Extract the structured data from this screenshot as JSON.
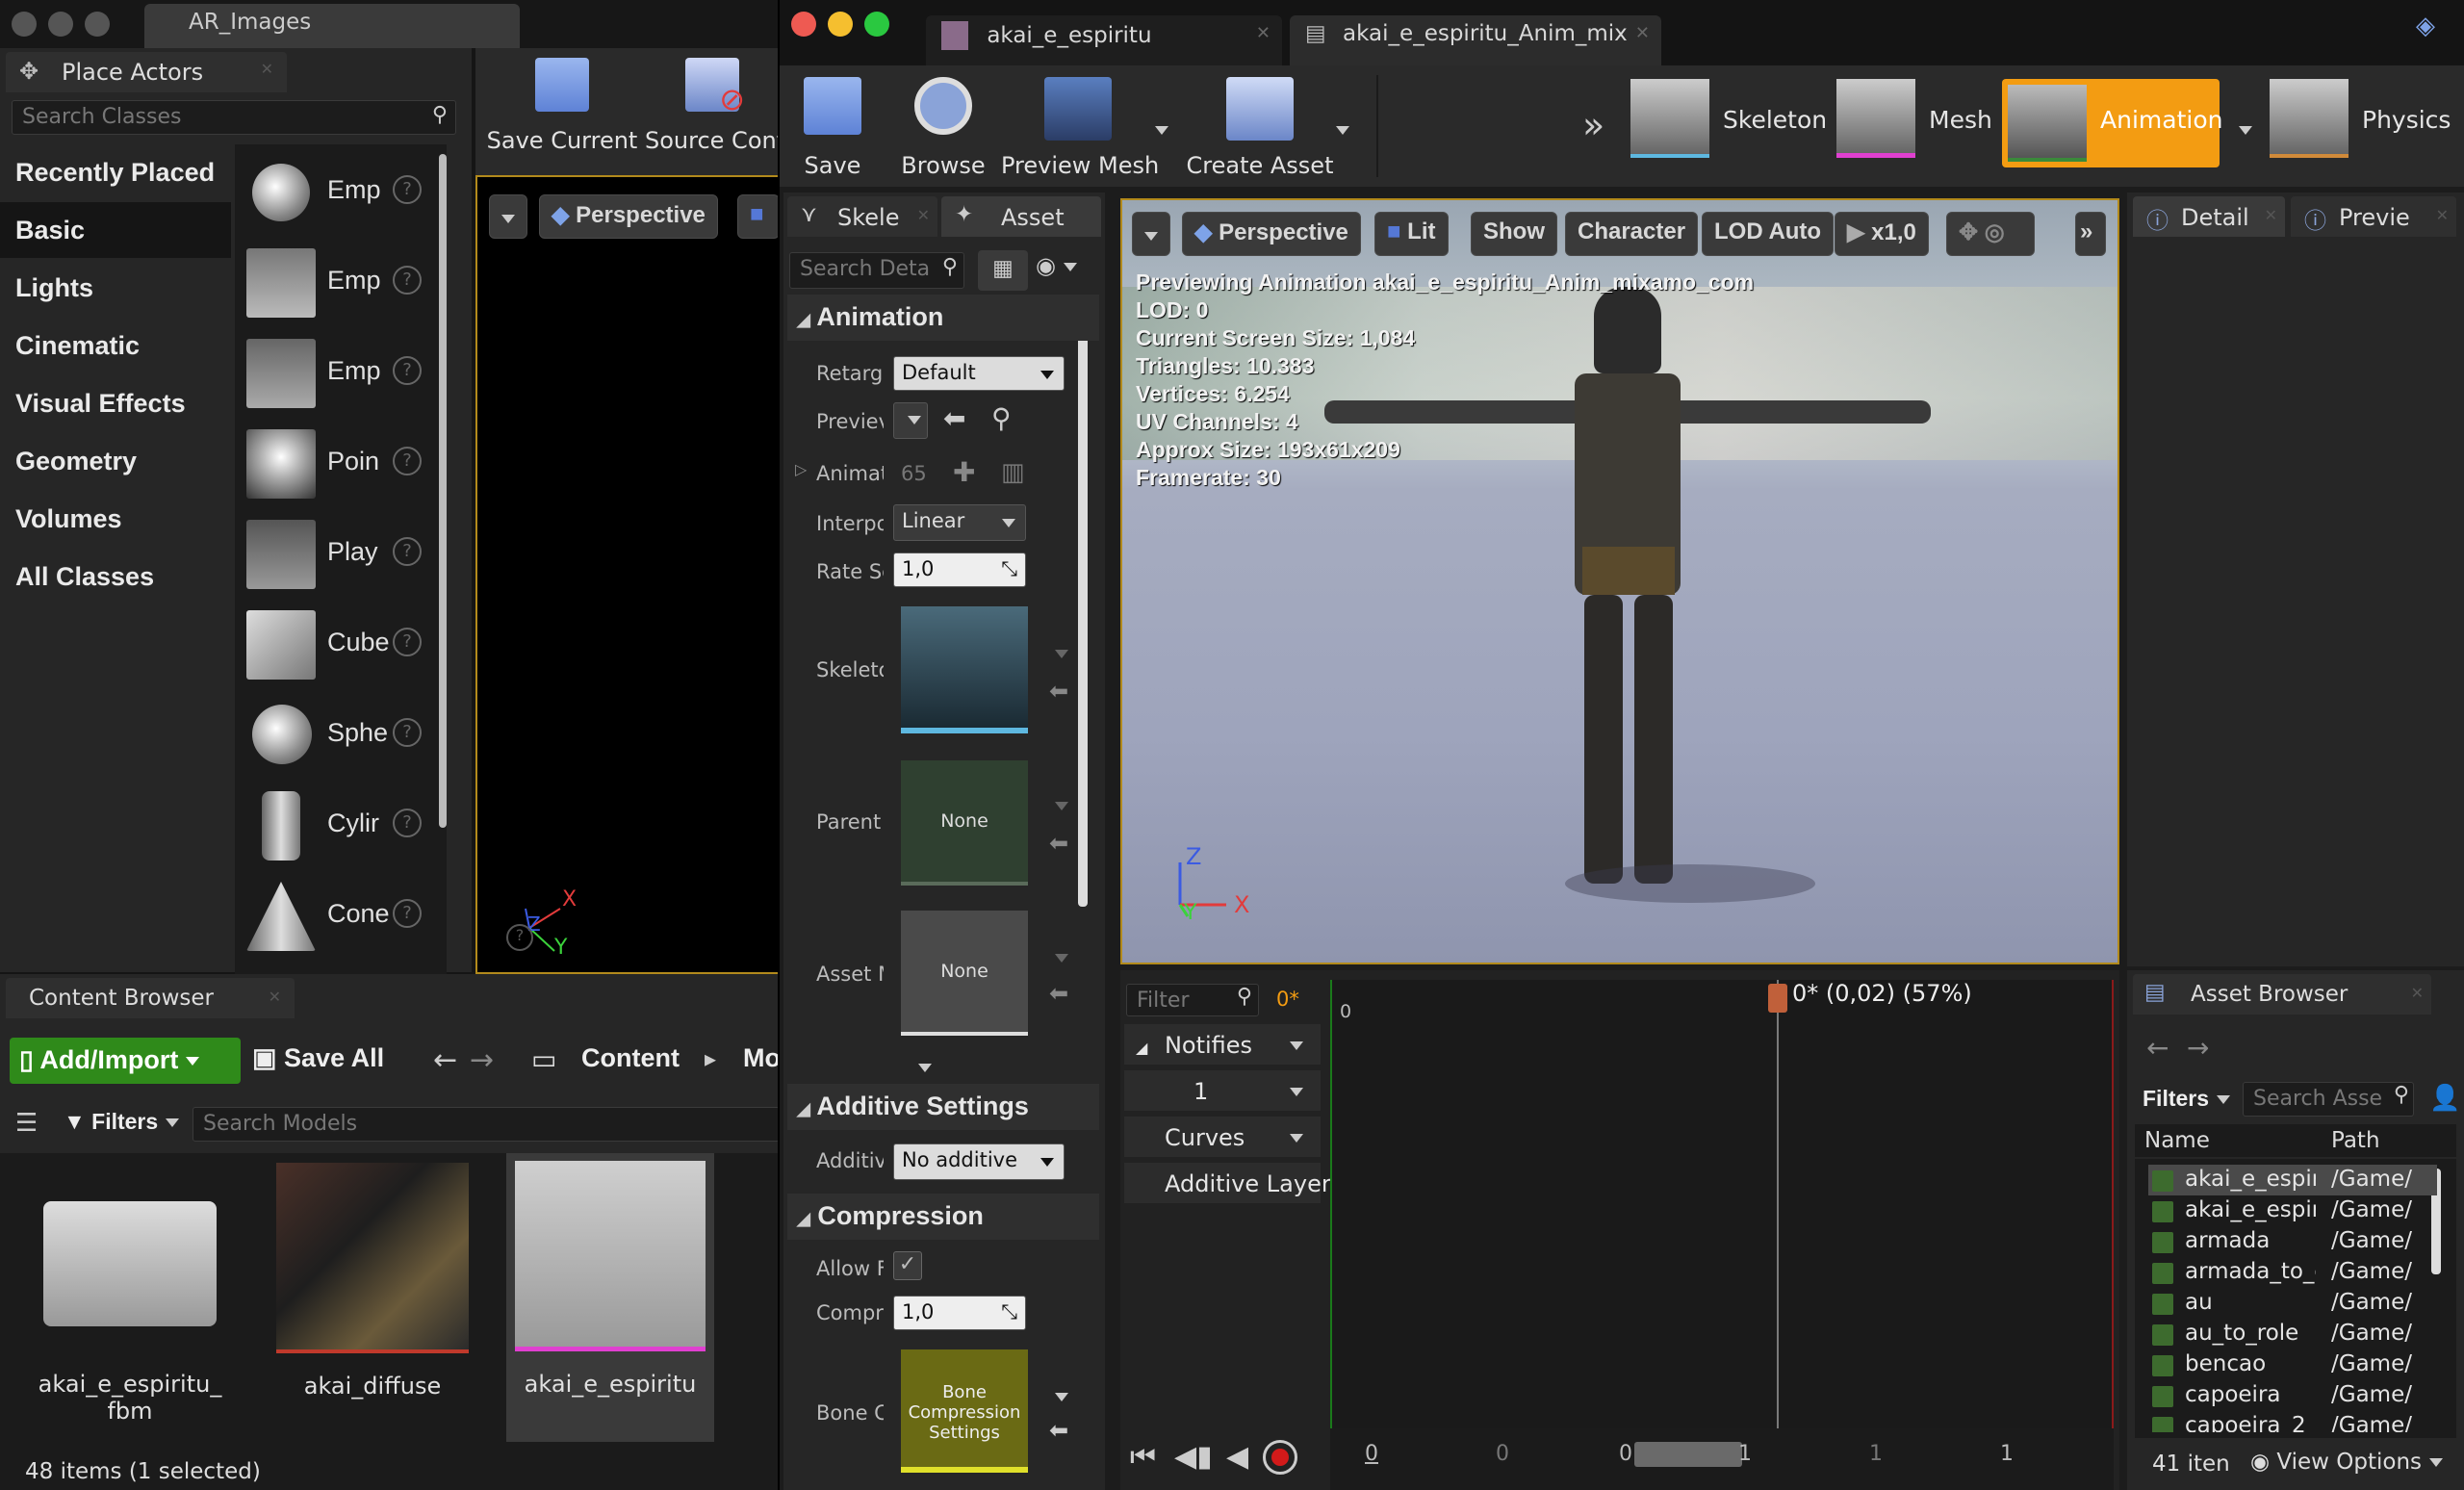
{
  "colors": {
    "accent_orange": "#f39c12",
    "green_button": "#2f8a1a",
    "viewport_gold": "#b28a1c",
    "pink_bar": "#e040d0"
  },
  "left_window": {
    "tab_title": "AR_Images"
  },
  "place_actors": {
    "tab": "Place Actors",
    "search_placeholder": "Search Classes",
    "categories": [
      "Recently Placed",
      "Basic",
      "Lights",
      "Cinematic",
      "Visual Effects",
      "Geometry",
      "Volumes",
      "All Classes"
    ],
    "selected_category": "Basic",
    "actors": [
      "Emp",
      "Emp",
      "Emp",
      "Poin",
      "Play",
      "Cube",
      "Sphe",
      "Cylir",
      "Cone"
    ]
  },
  "level_toolbar": {
    "save_current": "Save Current",
    "source_control": "Source Cont"
  },
  "level_viewport": {
    "perspective": "Perspective",
    "axis_x": "X",
    "axis_y": "Y",
    "axis_z": "Z"
  },
  "content_browser": {
    "tab": "Content Browser",
    "add_import": "Add/Import",
    "save_all": "Save All",
    "path_root": "Content",
    "path_next": "Mo",
    "filters": "Filters",
    "search_placeholder": "Search Models",
    "items": [
      "akai_e_espiritu_ fbm",
      "akai_diffuse",
      "akai_e_espiritu"
    ],
    "status": "48 items (1 selected)"
  },
  "anim_window": {
    "tabs": [
      "akai_e_espiritu",
      "akai_e_espiritu_Anim_mix"
    ],
    "toolbar": [
      "Save",
      "Browse",
      "Preview Mesh",
      "Create Asset"
    ],
    "modes": [
      "Skeleton",
      "Mesh",
      "Animation",
      "Physics"
    ],
    "active_mode": "Animation"
  },
  "details_panel": {
    "tabs": [
      "Skelet",
      "Asset"
    ],
    "search_placeholder": "Search Deta",
    "animation_section": "Animation",
    "props": {
      "retarget": "Retarge",
      "retarget_val": "Default",
      "preview": "Previev",
      "animation": "Animati",
      "animation_count": "65",
      "interp": "Interpol",
      "interp_val": "Linear",
      "rate": "Rate Sc",
      "rate_val": "1,0",
      "skeleton": "Skeleto",
      "parent": "Parent",
      "parent_val": "None",
      "asset_m": "Asset M",
      "asset_m_val": "None"
    },
    "additive_section": "Additive Settings",
    "additive": "Additiv",
    "additive_val": "No additive",
    "compression_section": "Compression",
    "allow": "Allow F",
    "compress": "Compre",
    "compress_val": "1,0",
    "bone": "Bone C",
    "bone_val": "Bone Compression Settings"
  },
  "anim_viewport": {
    "buttons": [
      "Perspective",
      "Lit",
      "Show",
      "Character",
      "LOD Auto",
      "x1,0"
    ],
    "hud": [
      "Previewing Animation akai_e_espiritu_Anim_mixamo_com",
      "LOD: 0",
      "Current Screen Size: 1,084",
      "Triangles: 10.383",
      "Vertices: 6.254",
      "UV Channels: 4",
      "Approx Size: 193x61x209",
      "Framerate: 30"
    ],
    "axis_x": "X",
    "axis_y": "Y",
    "axis_z": "Z"
  },
  "timeline": {
    "filter_placeholder": "Filter",
    "frame_marker": "0*",
    "ruler_start": "0",
    "scrub_label": "0* (0,02) (57%)",
    "tracks": [
      "Notifies",
      "1",
      "Curves",
      "Additive Layer"
    ],
    "bottom_numbers": [
      "0",
      "0",
      "0",
      "1",
      "1",
      "1"
    ],
    "playhead_pct": 57
  },
  "right_panel": {
    "tabs": [
      "Detail",
      "Previe"
    ]
  },
  "asset_browser": {
    "tab": "Asset Browser",
    "filters": "Filters",
    "search_placeholder": "Search Asse",
    "col_name": "Name",
    "col_path": "Path",
    "rows": [
      {
        "name": "akai_e_espirit",
        "path": "/Game/"
      },
      {
        "name": "akai_e_espirit",
        "path": "/Game/"
      },
      {
        "name": "armada",
        "path": "/Game/"
      },
      {
        "name": "armada_to_e",
        "path": "/Game/"
      },
      {
        "name": "au",
        "path": "/Game/"
      },
      {
        "name": "au_to_role",
        "path": "/Game/"
      },
      {
        "name": "bencao",
        "path": "/Game/"
      },
      {
        "name": "capoeira",
        "path": "/Game/"
      },
      {
        "name": "capoeira_2",
        "path": "/Game/"
      }
    ],
    "count": "41 iten",
    "view_options": "View Options"
  }
}
